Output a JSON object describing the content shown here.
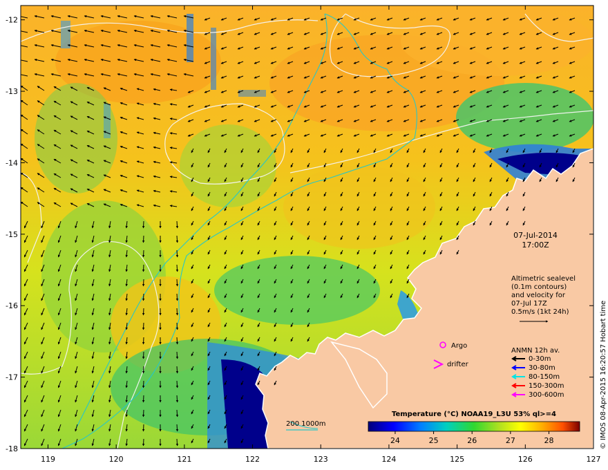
{
  "map": {
    "lon_range": [
      118.6,
      127
    ],
    "lat_range": [
      -18,
      -11.8
    ],
    "x_ticks": [
      "119",
      "120",
      "121",
      "122",
      "123",
      "124",
      "125",
      "126",
      "127"
    ],
    "y_ticks": [
      "-12",
      "-13",
      "-14",
      "-15",
      "-16",
      "-17",
      "-18"
    ],
    "colors": {
      "land": "#f9c9a4",
      "deep_blue": "#00008b",
      "coast_white": "#ffffff",
      "contour_white": "#f4f4f4",
      "bathy_cyan": "#27c7c7"
    }
  },
  "annotations": {
    "date": "07-Jul-2014",
    "time": "17:00Z",
    "alti_line1": "Altimetric sealevel",
    "alti_line2": "(0.1m contours)",
    "alti_line3": "and velocity for",
    "alti_line4": "07-Jul 17Z",
    "alti_line5": "0.5m/s (1kt 24h)",
    "argo": "Argo",
    "drifter": "drifter",
    "anmn_title": "ANMN 12h av.",
    "anmn": [
      {
        "label": "0-30m",
        "color": "#000000"
      },
      {
        "label": "30-80m",
        "color": "#0000ff"
      },
      {
        "label": "80-150m",
        "color": "#00e5e5"
      },
      {
        "label": "150-300m",
        "color": "#ff0000"
      },
      {
        "label": "300-600m",
        "color": "#ff00ff"
      }
    ],
    "bathy_label": "200  1000m",
    "side_credit": "© IMOS 08-Apr-2015 16:20:57 Hobart time"
  },
  "colorbar": {
    "title": "Temperature (°C) NOAA19_L3U 53% ql>=4",
    "ticks": [
      "24",
      "25",
      "26",
      "27",
      "28"
    ],
    "range": [
      23.3,
      28.8
    ]
  }
}
